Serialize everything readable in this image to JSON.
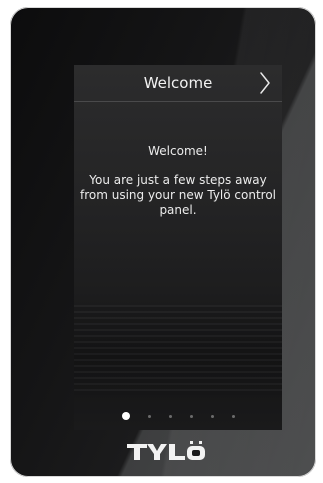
{
  "header": {
    "title": "Welcome",
    "next_icon": "chevron-right-icon"
  },
  "content": {
    "greeting": "Welcome!",
    "message": "You are just a few steps away from using your new Tylö control panel."
  },
  "pager": {
    "total": 6,
    "active_index": 0
  },
  "brand": {
    "logo_text": "TYLÖ"
  },
  "colors": {
    "text": "#ffffff",
    "dot_inactive": "#6b6b6c",
    "divider": "#4a4a4b"
  }
}
